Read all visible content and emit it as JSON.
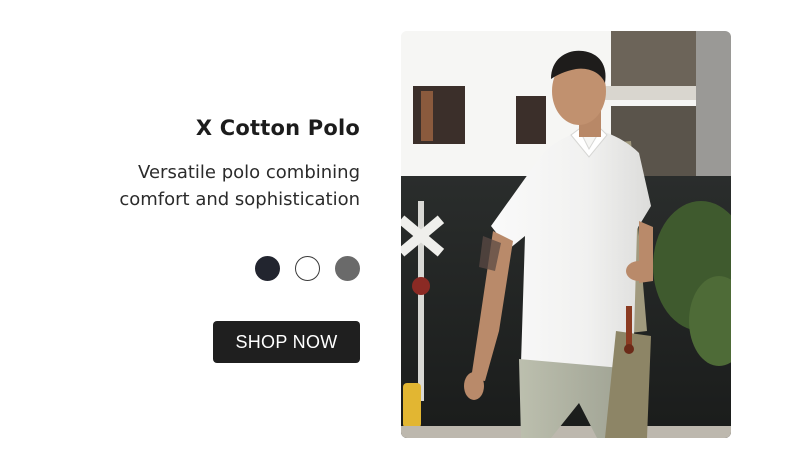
{
  "product": {
    "title": "X Cotton Polo",
    "description_line1": "Versatile polo combining",
    "description_line2": "comfort and sophistication",
    "cta_label": "SHOP NOW"
  },
  "swatches": [
    {
      "name": "navy",
      "color": "#22252f",
      "border": "#22252f"
    },
    {
      "name": "white",
      "color": "#ffffff",
      "border": "#3a3a3a"
    },
    {
      "name": "gray",
      "color": "#6a6a6a",
      "border": "#6a6a6a"
    }
  ],
  "colors": {
    "button_bg": "#1f1f1f",
    "text": "#1c1c1c"
  }
}
